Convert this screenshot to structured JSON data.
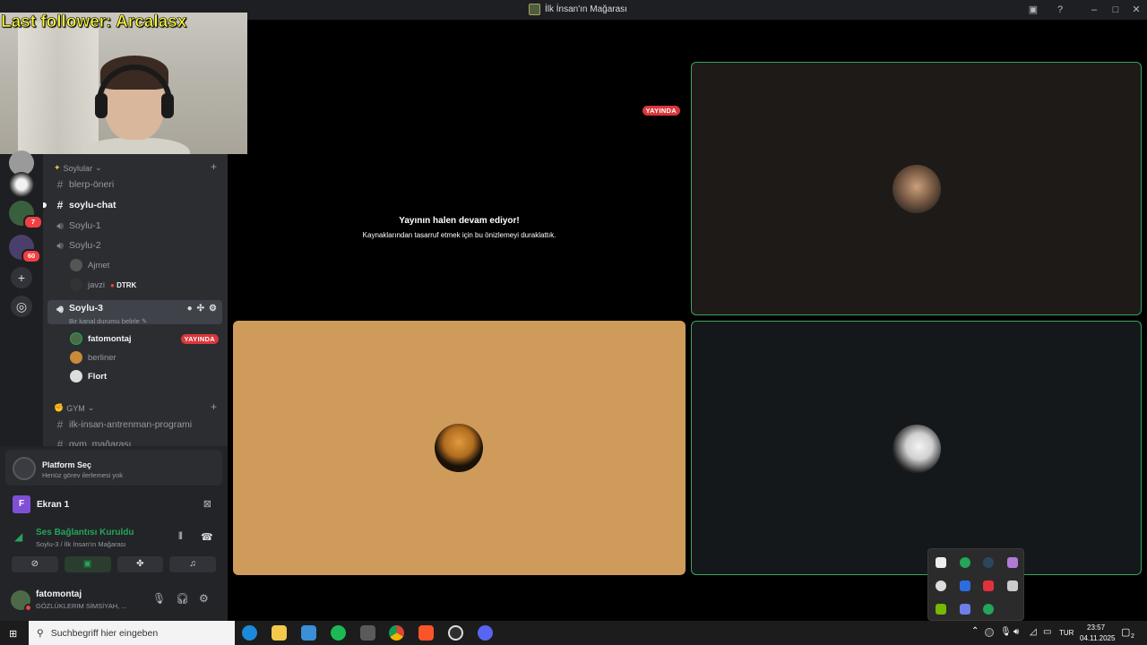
{
  "window": {
    "title": "İlk İnsan'ın Mağarası"
  },
  "overlay": {
    "follower_text": "Last follower: Arcalasx"
  },
  "servers": {
    "badges": [
      "7",
      "60"
    ]
  },
  "sidebar": {
    "categories": [
      {
        "name": "Soylular"
      },
      {
        "name": "GYM"
      }
    ],
    "channels": {
      "blerp": "blerp-öneri",
      "soylu_chat": "soylu-chat",
      "soylu1": "Soylu-1",
      "soylu2": "Soylu-2",
      "soylu3": "Soylu-3",
      "soylu3_status": "Bir kanal durumu belirle",
      "gym1": "ilk-insan-antrenman-programi",
      "gym2": "gym_mağarası"
    },
    "soylu2_users": [
      {
        "name": "Ajmet"
      },
      {
        "name": "javzi",
        "tag": "DTRK"
      }
    ],
    "soylu3_users": [
      {
        "name": "fatomontaj",
        "badge": "YAYINDA"
      },
      {
        "name": "berliner"
      },
      {
        "name": "Flort"
      }
    ]
  },
  "panel": {
    "activity": {
      "title": "Platform Seç",
      "subtitle": "Henüz görev ilerlemesi yok"
    },
    "screen": {
      "letter": "F",
      "label": "Ekran 1"
    },
    "voice": {
      "status": "Ses Bağlantısı Kuruldu",
      "location": "Soylu-3 / İlk İnsan'ın Mağarası"
    },
    "user": {
      "name": "fatomontaj",
      "status": "GÖZLÜKLERIM SİMSİYAH, ..."
    }
  },
  "stage": {
    "paused_title": "Yayının halen devam ediyor!",
    "paused_subtitle": "Kaynaklarından tasarruf etmek için bu önizlemeyi duraklattık.",
    "live_badge": "YAYINDA"
  },
  "taskbar": {
    "search_placeholder": "Suchbegriff hier eingeben",
    "language": "TUR",
    "time": "23:57",
    "date": "04.11.2025",
    "notif_count": "2"
  },
  "colors": {
    "accent_green": "#23a55a",
    "live_red": "#da373c",
    "brand_purple": "#7f4fd6",
    "speaking_border": "#3ba55c"
  }
}
